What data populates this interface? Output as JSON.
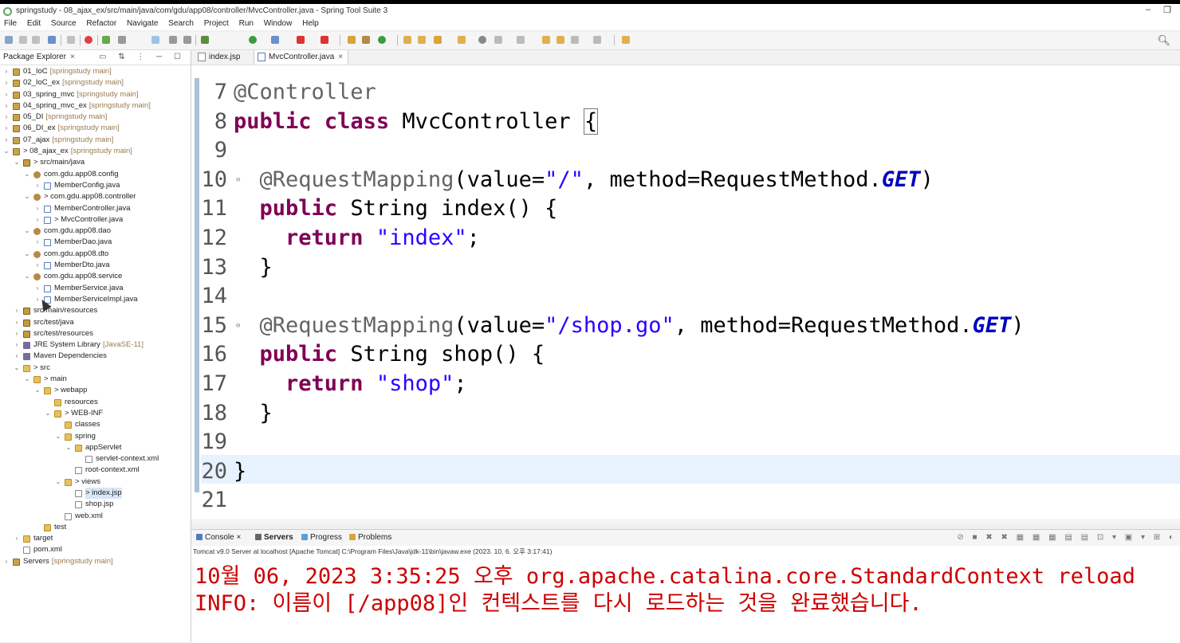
{
  "window": {
    "title": "springstudy - 08_ajax_ex/src/main/java/com/gdu/app08/controller/MvcController.java - Spring Tool Suite 3",
    "minimize": "–",
    "restore": "❐"
  },
  "menu": [
    "File",
    "Edit",
    "Source",
    "Refactor",
    "Navigate",
    "Search",
    "Project",
    "Run",
    "Window",
    "Help"
  ],
  "explorer": {
    "tab_label": "Package Explorer",
    "tab_close": "×",
    "tree": [
      {
        "label": "01_IoC",
        "suffix": "[springstudy main]",
        "indent": 0,
        "arrow": "›",
        "icon": "project"
      },
      {
        "label": "02_IoC_ex",
        "suffix": "[springstudy main]",
        "indent": 0,
        "arrow": "›",
        "icon": "project"
      },
      {
        "label": "03_spring_mvc",
        "suffix": "[springstudy main]",
        "indent": 0,
        "arrow": "›",
        "icon": "project"
      },
      {
        "label": "04_spring_mvc_ex",
        "suffix": "[springstudy main]",
        "indent": 0,
        "arrow": "›",
        "icon": "project"
      },
      {
        "label": "05_DI",
        "suffix": "[springstudy main]",
        "indent": 0,
        "arrow": "›",
        "icon": "project"
      },
      {
        "label": "06_DI_ex",
        "suffix": "[springstudy main]",
        "indent": 0,
        "arrow": "›",
        "icon": "project"
      },
      {
        "label": "07_ajax",
        "suffix": "[springstudy main]",
        "indent": 0,
        "arrow": "›",
        "icon": "project"
      },
      {
        "label": "> 08_ajax_ex",
        "suffix": "[springstudy main]",
        "indent": 0,
        "arrow": "⌄",
        "icon": "project"
      },
      {
        "label": "> src/main/java",
        "suffix": "",
        "indent": 1,
        "arrow": "⌄",
        "icon": "src"
      },
      {
        "label": "com.gdu.app08.config",
        "suffix": "",
        "indent": 2,
        "arrow": "⌄",
        "icon": "package"
      },
      {
        "label": "MemberConfig.java",
        "suffix": "",
        "indent": 3,
        "arrow": "›",
        "icon": "java"
      },
      {
        "label": "> com.gdu.app08.controller",
        "suffix": "",
        "indent": 2,
        "arrow": "⌄",
        "icon": "package"
      },
      {
        "label": "MemberController.java",
        "suffix": "",
        "indent": 3,
        "arrow": "›",
        "icon": "java"
      },
      {
        "label": "> MvcController.java",
        "suffix": "",
        "indent": 3,
        "arrow": "›",
        "icon": "java"
      },
      {
        "label": "com.gdu.app08.dao",
        "suffix": "",
        "indent": 2,
        "arrow": "⌄",
        "icon": "package"
      },
      {
        "label": "MemberDao.java",
        "suffix": "",
        "indent": 3,
        "arrow": "›",
        "icon": "java"
      },
      {
        "label": "com.gdu.app08.dto",
        "suffix": "",
        "indent": 2,
        "arrow": "⌄",
        "icon": "package"
      },
      {
        "label": "MemberDto.java",
        "suffix": "",
        "indent": 3,
        "arrow": "›",
        "icon": "java"
      },
      {
        "label": "com.gdu.app08.service",
        "suffix": "",
        "indent": 2,
        "arrow": "⌄",
        "icon": "package"
      },
      {
        "label": "MemberService.java",
        "suffix": "",
        "indent": 3,
        "arrow": "›",
        "icon": "java"
      },
      {
        "label": "MemberServiceImpl.java",
        "suffix": "",
        "indent": 3,
        "arrow": "›",
        "icon": "java"
      },
      {
        "label": "src/main/resources",
        "suffix": "",
        "indent": 1,
        "arrow": "›",
        "icon": "src"
      },
      {
        "label": "src/test/java",
        "suffix": "",
        "indent": 1,
        "arrow": "›",
        "icon": "src"
      },
      {
        "label": "src/test/resources",
        "suffix": "",
        "indent": 1,
        "arrow": "›",
        "icon": "src"
      },
      {
        "label": "JRE System Library",
        "suffix": "[JavaSE-11]",
        "indent": 1,
        "arrow": "›",
        "icon": "library"
      },
      {
        "label": "Maven Dependencies",
        "suffix": "",
        "indent": 1,
        "arrow": "›",
        "icon": "library"
      },
      {
        "label": "> src",
        "suffix": "",
        "indent": 1,
        "arrow": "⌄",
        "icon": "folder"
      },
      {
        "label": "> main",
        "suffix": "",
        "indent": 2,
        "arrow": "⌄",
        "icon": "folder"
      },
      {
        "label": "> webapp",
        "suffix": "",
        "indent": 3,
        "arrow": "⌄",
        "icon": "folder"
      },
      {
        "label": "resources",
        "suffix": "",
        "indent": 4,
        "arrow": "",
        "icon": "folder"
      },
      {
        "label": "> WEB-INF",
        "suffix": "",
        "indent": 4,
        "arrow": "⌄",
        "icon": "folder"
      },
      {
        "label": "classes",
        "suffix": "",
        "indent": 5,
        "arrow": "",
        "icon": "folder"
      },
      {
        "label": "spring",
        "suffix": "",
        "indent": 5,
        "arrow": "⌄",
        "icon": "folder"
      },
      {
        "label": "appServlet",
        "suffix": "",
        "indent": 6,
        "arrow": "⌄",
        "icon": "folder"
      },
      {
        "label": "servlet-context.xml",
        "suffix": "",
        "indent": 7,
        "arrow": "",
        "icon": "file"
      },
      {
        "label": "root-context.xml",
        "suffix": "",
        "indent": 6,
        "arrow": "",
        "icon": "file"
      },
      {
        "label": "> views",
        "suffix": "",
        "indent": 5,
        "arrow": "⌄",
        "icon": "folder"
      },
      {
        "label": "> index.jsp",
        "suffix": "",
        "indent": 6,
        "arrow": "",
        "icon": "file",
        "selected": true
      },
      {
        "label": "shop.jsp",
        "suffix": "",
        "indent": 6,
        "arrow": "",
        "icon": "file"
      },
      {
        "label": "web.xml",
        "suffix": "",
        "indent": 5,
        "arrow": "",
        "icon": "file"
      },
      {
        "label": "test",
        "suffix": "",
        "indent": 3,
        "arrow": "",
        "icon": "folder"
      },
      {
        "label": "target",
        "suffix": "",
        "indent": 1,
        "arrow": "›",
        "icon": "folder"
      },
      {
        "label": "pom.xml",
        "suffix": "",
        "indent": 1,
        "arrow": "",
        "icon": "file"
      },
      {
        "label": "Servers",
        "suffix": "[springstudy main]",
        "indent": 0,
        "arrow": "›",
        "icon": "project"
      }
    ]
  },
  "editor": {
    "tabs": [
      {
        "label": "index.jsp",
        "active": false
      },
      {
        "label": "MvcController.java",
        "active": true
      }
    ],
    "tab_close": "×",
    "lines": [
      {
        "no": "7",
        "fold": false,
        "tokens": [
          {
            "t": "@Controller",
            "c": "ann"
          }
        ]
      },
      {
        "no": "8",
        "fold": false,
        "tokens": [
          {
            "t": "public",
            "c": "kw"
          },
          {
            "t": " ",
            "c": ""
          },
          {
            "t": "class",
            "c": "kw"
          },
          {
            "t": " MvcController ",
            "c": ""
          },
          {
            "t": "{",
            "c": "box"
          }
        ]
      },
      {
        "no": "9",
        "fold": false,
        "tokens": []
      },
      {
        "no": "10",
        "fold": true,
        "tokens": [
          {
            "t": "  ",
            "c": ""
          },
          {
            "t": "@RequestMapping",
            "c": "ann"
          },
          {
            "t": "(value=",
            "c": ""
          },
          {
            "t": "\"/\"",
            "c": "str"
          },
          {
            "t": ", method=RequestMethod.",
            "c": ""
          },
          {
            "t": "GET",
            "c": "const"
          },
          {
            "t": ")",
            "c": ""
          }
        ]
      },
      {
        "no": "11",
        "fold": false,
        "tokens": [
          {
            "t": "  ",
            "c": ""
          },
          {
            "t": "public",
            "c": "kw"
          },
          {
            "t": " String index() {",
            "c": ""
          }
        ]
      },
      {
        "no": "12",
        "fold": false,
        "tokens": [
          {
            "t": "    ",
            "c": ""
          },
          {
            "t": "return",
            "c": "kw"
          },
          {
            "t": " ",
            "c": ""
          },
          {
            "t": "\"index\"",
            "c": "str"
          },
          {
            "t": ";",
            "c": ""
          }
        ]
      },
      {
        "no": "13",
        "fold": false,
        "tokens": [
          {
            "t": "  }",
            "c": ""
          }
        ]
      },
      {
        "no": "14",
        "fold": false,
        "tokens": []
      },
      {
        "no": "15",
        "fold": true,
        "tokens": [
          {
            "t": "  ",
            "c": ""
          },
          {
            "t": "@RequestMapping",
            "c": "ann"
          },
          {
            "t": "(value=",
            "c": ""
          },
          {
            "t": "\"/shop.go\"",
            "c": "str"
          },
          {
            "t": ", method=RequestMethod.",
            "c": ""
          },
          {
            "t": "GET",
            "c": "const"
          },
          {
            "t": ")",
            "c": ""
          }
        ]
      },
      {
        "no": "16",
        "fold": false,
        "tokens": [
          {
            "t": "  ",
            "c": ""
          },
          {
            "t": "public",
            "c": "kw"
          },
          {
            "t": " String shop() {",
            "c": ""
          }
        ]
      },
      {
        "no": "17",
        "fold": false,
        "tokens": [
          {
            "t": "    ",
            "c": ""
          },
          {
            "t": "return",
            "c": "kw"
          },
          {
            "t": " ",
            "c": ""
          },
          {
            "t": "\"shop\"",
            "c": "str"
          },
          {
            "t": ";",
            "c": ""
          }
        ]
      },
      {
        "no": "18",
        "fold": false,
        "tokens": [
          {
            "t": "  }",
            "c": ""
          }
        ]
      },
      {
        "no": "19",
        "fold": false,
        "tokens": []
      },
      {
        "no": "20",
        "fold": false,
        "tokens": [
          {
            "t": "}",
            "c": ""
          }
        ]
      },
      {
        "no": "21",
        "fold": false,
        "tokens": []
      }
    ]
  },
  "console": {
    "tabs": [
      {
        "label": "Console",
        "active": false
      },
      {
        "label": "Servers",
        "active": true
      },
      {
        "label": "Progress",
        "active": false
      },
      {
        "label": "Problems",
        "active": false
      }
    ],
    "tab_close": "×",
    "status": "Tomcat v9.0 Server at localhost [Apache Tomcat] C:\\Program Files\\Java\\jdk-11\\bin\\javaw.exe  (2023. 10. 6. 오후 3:17:41)",
    "lines": [
      "10월 06, 2023 3:35:25 오후 org.apache.catalina.core.StandardContext reload",
      "INFO: 이름이 [/app08]인 컨텍스트를 다시 로드하는 것을 완료했습니다."
    ]
  },
  "colors": {
    "keyword": "#7f0055",
    "string": "#2a00ff",
    "annotation": "#646464",
    "constant": "#0000c0",
    "console_text": "#cc0000",
    "current_line": "#e8f2fe"
  }
}
